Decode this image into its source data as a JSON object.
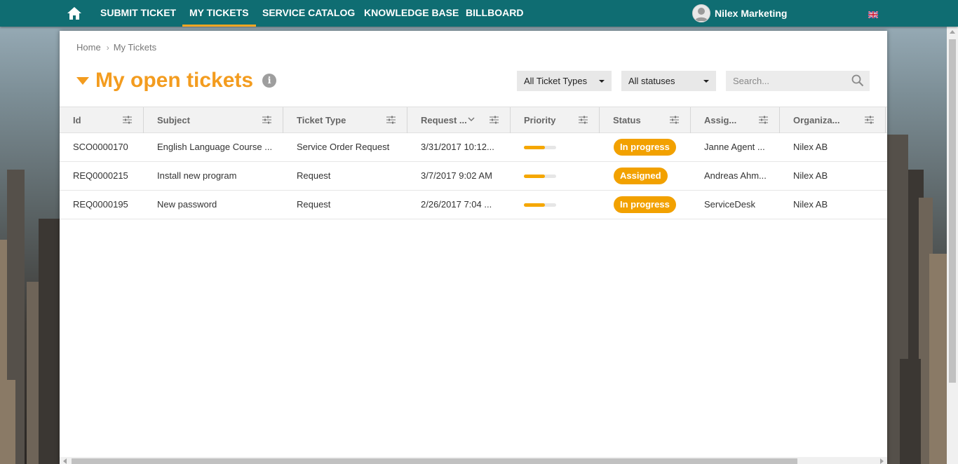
{
  "nav": {
    "items": [
      {
        "label": "SUBMIT TICKET"
      },
      {
        "label": "MY TICKETS"
      },
      {
        "label": "SERVICE CATALOG"
      },
      {
        "label": "KNOWLEDGE BASE"
      },
      {
        "label": "BILLBOARD"
      }
    ],
    "active": "MY TICKETS",
    "user_name": "Nilex Marketing",
    "language_icon": "uk-flag-icon"
  },
  "breadcrumb": {
    "home": "Home",
    "current": "My Tickets"
  },
  "page": {
    "title": "My open tickets",
    "info": "i"
  },
  "filters": {
    "ticket_type": "All Ticket Types",
    "status": "All statuses",
    "search_placeholder": "Search..."
  },
  "table": {
    "columns": [
      "Id",
      "Subject",
      "Ticket Type",
      "Request ...",
      "Priority",
      "Status",
      "Assig...",
      "Organiza..."
    ],
    "rows": [
      {
        "id": "SCO0000170",
        "subject": "English Language Course ...",
        "type": "Service Order Request",
        "request": "3/31/2017 10:12...",
        "priority": 0.65,
        "status": "In progress",
        "assigned": "Janne Agent ...",
        "org": "Nilex AB"
      },
      {
        "id": "REQ0000215",
        "subject": "Install new program",
        "type": "Request",
        "request": "3/7/2017 9:02 AM",
        "priority": 0.65,
        "status": "Assigned",
        "assigned": "Andreas Ahm...",
        "org": "Nilex AB"
      },
      {
        "id": "REQ0000195",
        "subject": "New password",
        "type": "Request",
        "request": "2/26/2017 7:04 ...",
        "priority": 0.65,
        "status": "In progress",
        "assigned": "ServiceDesk",
        "org": "Nilex AB"
      }
    ]
  },
  "colors": {
    "nav_bg": "#0f6d72",
    "accent": "#f39c1f",
    "badge": "#f2a100"
  }
}
